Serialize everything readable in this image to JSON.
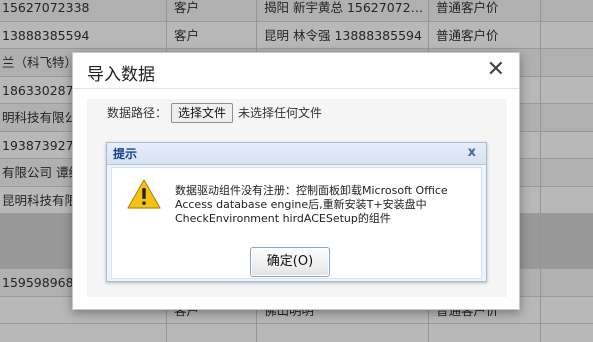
{
  "background_table": {
    "rows": [
      [
        "15627072338",
        "客户",
        "揭阳 新宇黄总 15627072…",
        "普通客户价"
      ],
      [
        "13888385594",
        "客户",
        "昆明 林令强 13888385594",
        "普通客户价"
      ],
      [
        "兰（科飞特）",
        "",
        "",
        ""
      ],
      [
        "18633028781",
        "",
        "",
        ""
      ],
      [
        "明科技有限公司",
        "",
        "",
        ""
      ],
      [
        "1938739278",
        "",
        "",
        ""
      ],
      [
        "有限公司 谭维",
        "",
        "",
        ""
      ],
      [
        "昆明科技有限公司",
        "",
        "",
        ""
      ],
      [
        "",
        "",
        "",
        ""
      ],
      [
        "",
        "",
        "",
        ""
      ],
      [
        "15959896868",
        "",
        "",
        ""
      ],
      [
        "",
        "客户",
        "佛山明明",
        "普通客户价"
      ]
    ]
  },
  "import_dialog": {
    "title": "导入数据",
    "path_label": "数据路径：",
    "choose_file_button": "选择文件",
    "file_status": "未选择任何文件"
  },
  "alert_dialog": {
    "title": "提示",
    "close_symbol": "x",
    "message": "数据驱动组件没有注册：控制面板卸载Microsoft Office Access database engine后,重新安装T+安装盘中CheckEnvironment hirdACESetup的组件",
    "ok_button": "确定(O)"
  },
  "colors": {
    "alert_title": "#15428b",
    "warning_icon": "#f5c211"
  }
}
